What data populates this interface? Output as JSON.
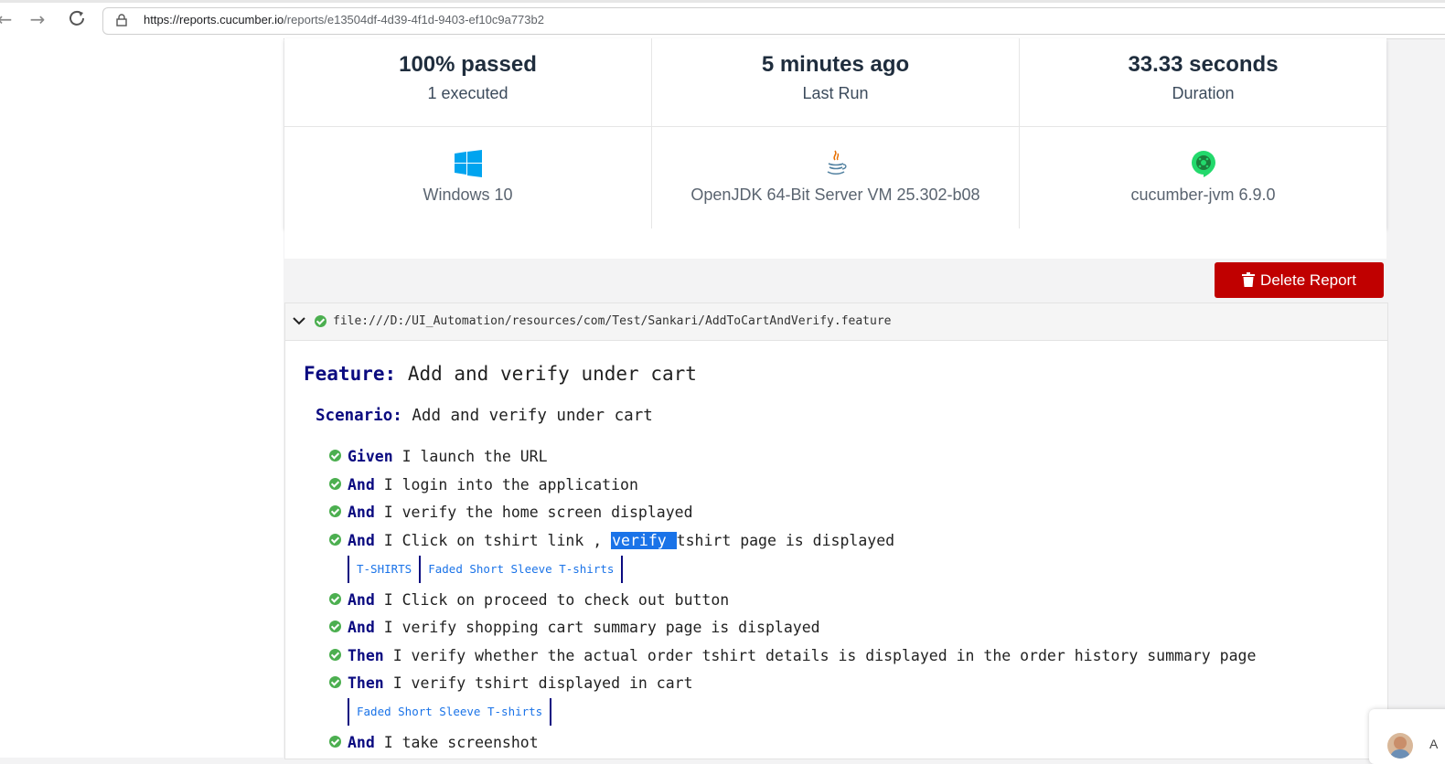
{
  "browser": {
    "url_host": "https://reports.cucumber.io",
    "url_path": "/reports/e13504df-4d39-4f1d-9403-ef10c9a773b2"
  },
  "stats": {
    "passed": "100% passed",
    "executed": "1 executed",
    "last_run_value": "5 minutes ago",
    "last_run_label": "Last Run",
    "duration_value": "33.33 seconds",
    "duration_label": "Duration"
  },
  "environment": {
    "os": {
      "icon": "windows-icon",
      "label": "Windows 10"
    },
    "runtime": {
      "icon": "java-icon",
      "label": "OpenJDK 64-Bit Server VM 25.302-b08"
    },
    "tool": {
      "icon": "cucumber-icon",
      "label": "cucumber-jvm 6.9.0"
    }
  },
  "actions": {
    "delete_label": "Delete Report"
  },
  "feature": {
    "path": "file:///D:/UI_Automation/resources/com/Test/Sankari/AddToCartAndVerify.feature",
    "keyword": "Feature:",
    "name": "Add and verify under cart",
    "scenario_keyword": "Scenario:",
    "scenario_name": "Add and verify under cart",
    "steps": [
      {
        "keyword": "Given",
        "text": "I launch the URL"
      },
      {
        "keyword": "And",
        "text": "I login into the application"
      },
      {
        "keyword": "And",
        "text": "I verify the home screen displayed"
      },
      {
        "keyword": "And",
        "text_before": "I Click on tshirt link , ",
        "text_highlight": "verify ",
        "text_after": "tshirt page is displayed"
      },
      {
        "keyword": "And",
        "text": "I Click on proceed to check out button"
      },
      {
        "keyword": "And",
        "text": "I verify shopping cart summary page is displayed"
      },
      {
        "keyword": "Then",
        "text": "I verify whether the actual order tshirt details is displayed in the order history summary page"
      },
      {
        "keyword": "Then",
        "text": "I verify tshirt displayed in cart"
      },
      {
        "keyword": "And",
        "text": "I take screenshot"
      }
    ],
    "table1": [
      "T-SHIRTS",
      "Faded Short Sleeve T-shirts"
    ],
    "table2": [
      "Faded Short Sleeve T-shirts"
    ]
  },
  "chat": {
    "letter": "A"
  },
  "colors": {
    "delete": "#c00000",
    "passed": "#4caf50",
    "keyword": "#0a0a80",
    "link": "#1a73e8"
  }
}
